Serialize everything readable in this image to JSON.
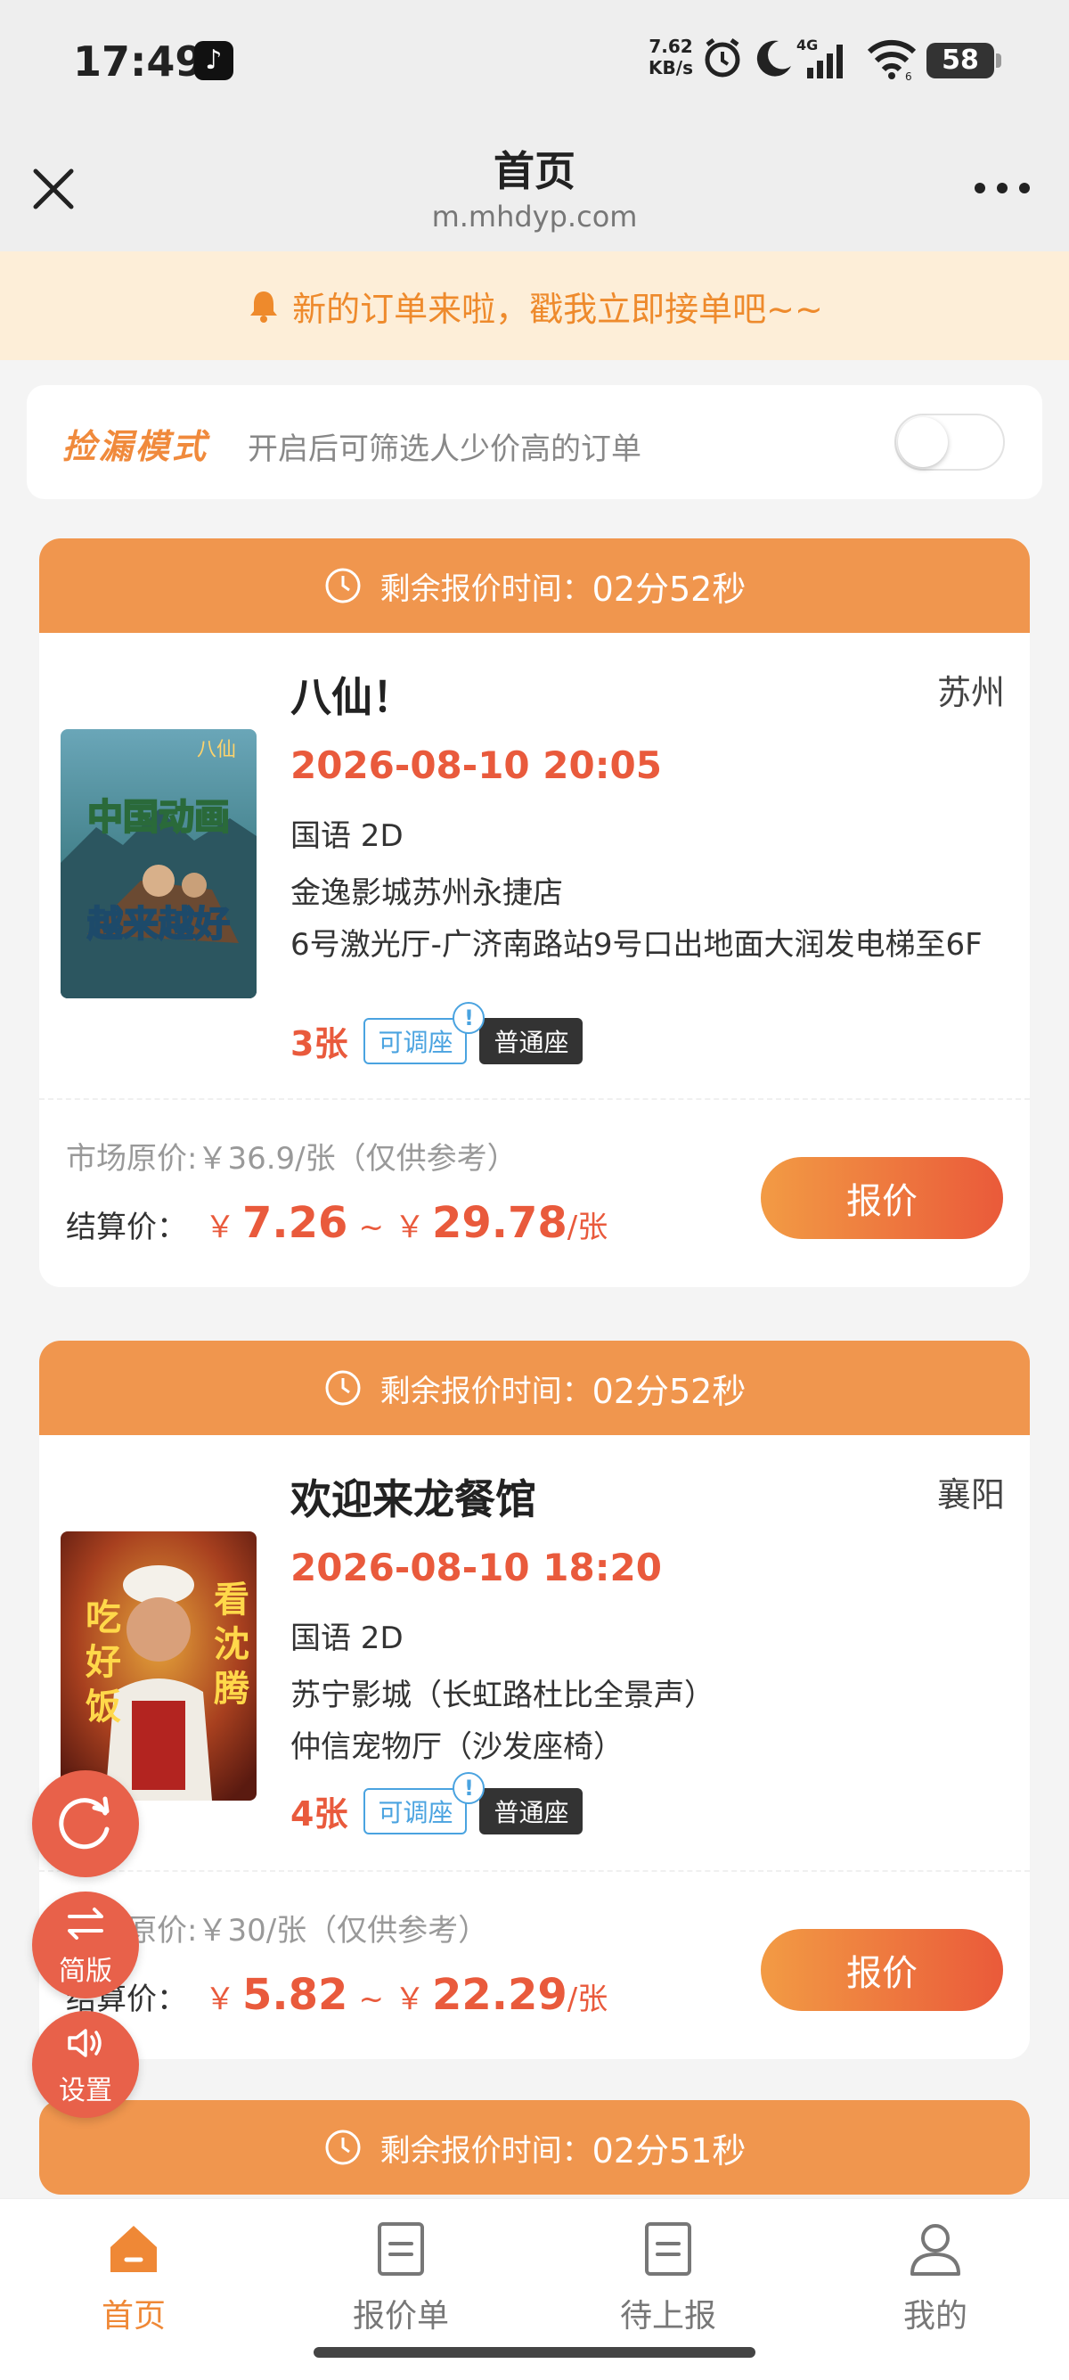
{
  "status_bar": {
    "time": "17:49",
    "net_speed_value": "7.62",
    "net_speed_unit": "KB/s",
    "network": "4G",
    "wifi_level": "6",
    "battery": "58",
    "icons": [
      "tiktok-icon",
      "alarm-icon",
      "moon-icon",
      "signal-icon",
      "wifi-icon",
      "battery-icon"
    ]
  },
  "header": {
    "title": "首页",
    "url": "m.mhdyp.com",
    "close_icon": "close-icon",
    "more_icon": "more-icon"
  },
  "notice": {
    "text": "新的订单来啦，戳我立即接单吧~~",
    "icon": "bell-icon",
    "color": "#ee8a2c"
  },
  "mode": {
    "title": "捡漏模式",
    "description": "开启后可筛选人少价高的订单",
    "enabled": false
  },
  "orders": [
    {
      "remaining_label": "剩余报价时间：",
      "remaining_time": "02分52秒",
      "title": "八仙！",
      "city": "苏州",
      "datetime": "2026-08-10 20:05",
      "language": "国语 2D",
      "cinema": "金逸影城苏州永捷店",
      "hall": "6号激光厅-广济南路站9号口出地面大润发电梯至6F",
      "tickets": "3张",
      "tag_adjust": "可调座",
      "tag_seat": "普通座",
      "poster_text_top": "中国动画",
      "poster_text_bottom": "越来越好",
      "poster_logo": "八仙",
      "market_price": "市场原价:￥36.9/张（仅供参考）",
      "settle_label": "结算价：",
      "currency": "￥",
      "price_min": "7.26",
      "price_sep": "~",
      "price_max": "29.78",
      "price_unit": "/张",
      "quote_button": "报价"
    },
    {
      "remaining_label": "剩余报价时间：",
      "remaining_time": "02分52秒",
      "title": "欢迎来龙餐馆",
      "city": "襄阳",
      "datetime": "2026-08-10 18:20",
      "language": "国语 2D",
      "cinema": "苏宁影城（长虹路杜比全景声）",
      "hall": "仲信宠物厅（沙发座椅）",
      "tickets": "4张",
      "tag_adjust": "可调座",
      "tag_seat": "普通座",
      "poster_text_left": "吃好饭",
      "poster_text_right": "看沈腾",
      "market_price": "市场原价:￥30/张（仅供参考）",
      "settle_label": "结算价：",
      "currency": "￥",
      "price_min": "5.82",
      "price_sep": "~",
      "price_max": "22.29",
      "price_unit": "/张",
      "quote_button": "报价"
    },
    {
      "remaining_label": "剩余报价时间：",
      "remaining_time": "02分51秒"
    }
  ],
  "fabs": {
    "refresh_icon": "refresh-icon",
    "simple_label": "简版",
    "simple_icon": "swap-icon",
    "settings_label": "设置",
    "settings_icon": "speaker-icon"
  },
  "bottom_nav": {
    "items": [
      {
        "label": "首页",
        "icon": "home-icon",
        "active": true
      },
      {
        "label": "报价单",
        "icon": "document-icon",
        "active": false
      },
      {
        "label": "待上报",
        "icon": "document-icon",
        "active": false
      },
      {
        "label": "我的",
        "icon": "user-icon",
        "active": false
      }
    ]
  },
  "colors": {
    "accent": "#f0964e",
    "price": "#e95a3c",
    "active_nav": "#ef8836",
    "tag_blue": "#4aa3e0"
  }
}
